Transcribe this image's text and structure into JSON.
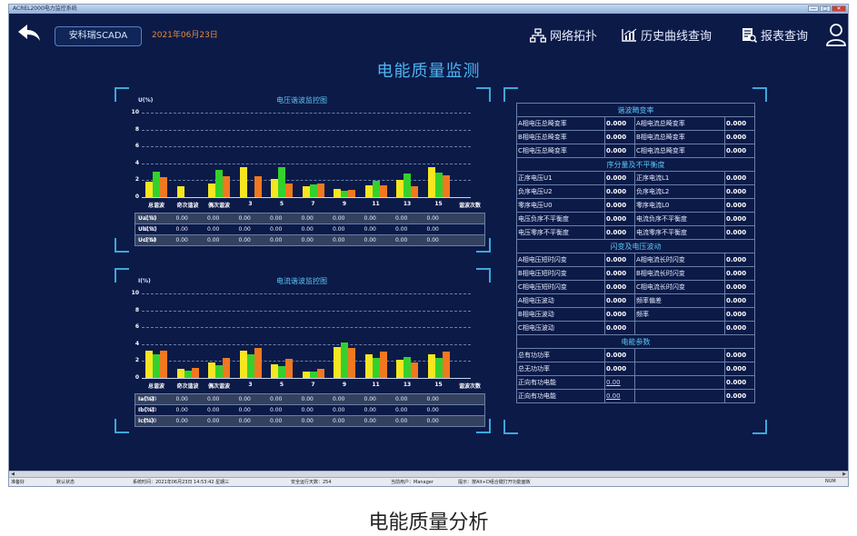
{
  "window": {
    "title": "ACREL2000电力监控系统",
    "min": "—",
    "max": "□",
    "close": "✕"
  },
  "appbar": {
    "brand": "安科瑞SCADA",
    "date": "2021年06月23日",
    "nav": [
      {
        "label": "网络拓扑",
        "icon": "network-icon"
      },
      {
        "label": "历史曲线查询",
        "icon": "chart-icon"
      },
      {
        "label": "报表查询",
        "icon": "report-icon"
      }
    ],
    "user_icon": "user-icon"
  },
  "page_title": "电能质量监测",
  "voltage_chart": {
    "title": "电压谐波监控图",
    "ylabel": "U(%)",
    "ylim": [
      0,
      10
    ],
    "yticks": [
      "10",
      "8",
      "6",
      "4",
      "2",
      "0"
    ],
    "categories": [
      "总谐波",
      "奇次谐波",
      "偶次谐波",
      "3",
      "5",
      "7",
      "9",
      "11",
      "13",
      "15"
    ],
    "xlabel": "谐波次数",
    "colors": [
      "#f5e620",
      "#34d12c",
      "#f07820"
    ],
    "series": [
      {
        "values": [
          1.8,
          1.3,
          1.6,
          3.5,
          2.1,
          1.3,
          1.0,
          1.4,
          2.0,
          3.5
        ]
      },
      {
        "values": [
          3.0,
          0,
          3.2,
          0,
          3.5,
          1.5,
          0.8,
          1.9,
          2.8,
          2.9
        ]
      },
      {
        "values": [
          2.4,
          0,
          2.5,
          2.5,
          1.6,
          1.6,
          0.9,
          1.4,
          1.3,
          2.6
        ]
      }
    ],
    "rows": [
      {
        "label": "Ua(%)",
        "values": [
          "0.00",
          "0.00",
          "0.00",
          "0.00",
          "0.00",
          "0.00",
          "0.00",
          "0.00",
          "0.00",
          "0.00"
        ]
      },
      {
        "label": "Ub(%)",
        "values": [
          "0.00",
          "0.00",
          "0.00",
          "0.00",
          "0.00",
          "0.00",
          "0.00",
          "0.00",
          "0.00",
          "0.00"
        ]
      },
      {
        "label": "Uc(%)",
        "values": [
          "0.00",
          "0.00",
          "0.00",
          "0.00",
          "0.00",
          "0.00",
          "0.00",
          "0.00",
          "0.00",
          "0.00"
        ]
      }
    ]
  },
  "current_chart": {
    "title": "电流谐波监控图",
    "ylabel": "I(%)",
    "ylim": [
      0,
      10
    ],
    "yticks": [
      "10",
      "8",
      "6",
      "4",
      "2",
      "0"
    ],
    "categories": [
      "总谐波",
      "奇次谐波",
      "偶次谐波",
      "3",
      "5",
      "7",
      "9",
      "11",
      "13",
      "15"
    ],
    "xlabel": "谐波次数",
    "colors": [
      "#f5e620",
      "#34d12c",
      "#f07820"
    ],
    "series": [
      {
        "values": [
          3.2,
          1.1,
          1.8,
          3.2,
          1.6,
          0.8,
          3.7,
          2.8,
          2.2,
          2.8
        ]
      },
      {
        "values": [
          2.8,
          0.9,
          1.5,
          2.8,
          1.4,
          0.7,
          4.2,
          2.4,
          2.5,
          2.4
        ]
      },
      {
        "values": [
          3.2,
          1.2,
          2.4,
          3.6,
          2.3,
          1.1,
          3.5,
          3.1,
          1.8,
          3.1
        ]
      }
    ],
    "rows": [
      {
        "label": "Ia(%)",
        "values": [
          "0.00",
          "0.00",
          "0.00",
          "0.00",
          "0.00",
          "0.00",
          "0.00",
          "0.00",
          "0.00",
          "0.00"
        ]
      },
      {
        "label": "Ib(%)",
        "values": [
          "0.00",
          "0.00",
          "0.00",
          "0.00",
          "0.00",
          "0.00",
          "0.00",
          "0.00",
          "0.00",
          "0.00"
        ]
      },
      {
        "label": "Ic(%)",
        "values": [
          "0.00",
          "0.00",
          "0.00",
          "0.00",
          "0.00",
          "0.00",
          "0.00",
          "0.00",
          "0.00",
          "0.00"
        ]
      }
    ]
  },
  "params": {
    "sections": [
      {
        "title": "谐波畸变率",
        "rows": [
          [
            "A相电压总畸变率",
            "0.000",
            "A相电流总畸变率",
            "0.000"
          ],
          [
            "B相电压总畸变率",
            "0.000",
            "B相电流总畸变率",
            "0.000"
          ],
          [
            "C相电压总畸变率",
            "0.000",
            "C相电流总畸变率",
            "0.000"
          ]
        ]
      },
      {
        "title": "序分量及不平衡度",
        "rows": [
          [
            "正序电压U1",
            "0.000",
            "正序电流L1",
            "0.000"
          ],
          [
            "负序电压U2",
            "0.000",
            "负序电流L2",
            "0.000"
          ],
          [
            "零序电压U0",
            "0.000",
            "零序电流L0",
            "0.000"
          ],
          [
            "电压负序不平衡度",
            "0.000",
            "电流负序不平衡度",
            "0.000"
          ],
          [
            "电压零序不平衡度",
            "0.000",
            "电流零序不平衡度",
            "0.000"
          ]
        ]
      },
      {
        "title": "闪变及电压波动",
        "rows": [
          [
            "A相电压短时闪变",
            "0.000",
            "A相电流长时闪变",
            "0.000"
          ],
          [
            "B相电压短时闪变",
            "0.000",
            "B相电流长时闪变",
            "0.000"
          ],
          [
            "C相电压短时闪变",
            "0.000",
            "C相电流长时闪变",
            "0.000"
          ],
          [
            "A相电压波动",
            "0.000",
            "频率偏差",
            "0.000"
          ],
          [
            "B相电压波动",
            "0.000",
            "频率",
            "0.000"
          ],
          [
            "C相电压波动",
            "0.000",
            "",
            "0.000"
          ]
        ]
      },
      {
        "title": "电能参数",
        "rows": [
          [
            "总有功功率",
            "0.000",
            "",
            "0.000"
          ],
          [
            "总无功功率",
            "0.000",
            "",
            "0.000"
          ],
          [
            "正向有功电能",
            "0.00",
            "",
            "0.000"
          ],
          [
            "正向有功电能",
            "0.00",
            "",
            "0.000"
          ]
        ]
      }
    ]
  },
  "statusbar": {
    "ready": "准备好",
    "mode": "默认状态",
    "systime": "系统时间：2021年06月23日  14:53:42  星期三",
    "days": "安全运行天数：254",
    "user": "当前用户：Manager",
    "hint": "提示：按Alt+D组合键打开功能面板",
    "num": "NUM"
  },
  "caption": "电能质量分析"
}
